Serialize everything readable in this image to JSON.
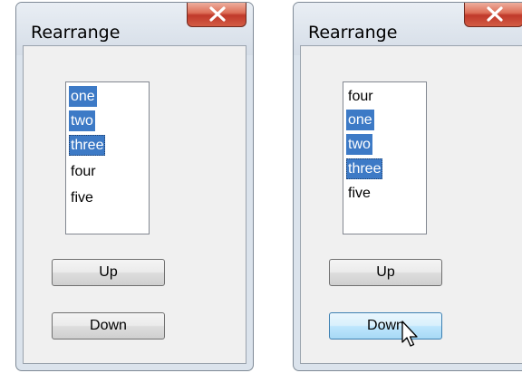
{
  "windows": [
    {
      "title": "Rearrange",
      "list_items": [
        {
          "label": "one",
          "selected": true
        },
        {
          "label": "two",
          "selected": true
        },
        {
          "label": "three",
          "selected": true
        },
        {
          "label": "four",
          "selected": false
        },
        {
          "label": "five",
          "selected": false
        }
      ],
      "up_label": "Up",
      "down_label": "Down"
    },
    {
      "title": "Rearrange",
      "list_items": [
        {
          "label": "four",
          "selected": false
        },
        {
          "label": "one",
          "selected": true
        },
        {
          "label": "two",
          "selected": true
        },
        {
          "label": "three",
          "selected": true
        },
        {
          "label": "five",
          "selected": false
        }
      ],
      "up_label": "Up",
      "down_label": "Down",
      "hovered_button": "down"
    }
  ],
  "icons": {
    "close": "close-x-icon",
    "cursor": "mouse-pointer-icon"
  },
  "colors": {
    "selection": "#3d7ac6",
    "close_button": "#c0392b",
    "hover_button": "#bee6fd"
  }
}
